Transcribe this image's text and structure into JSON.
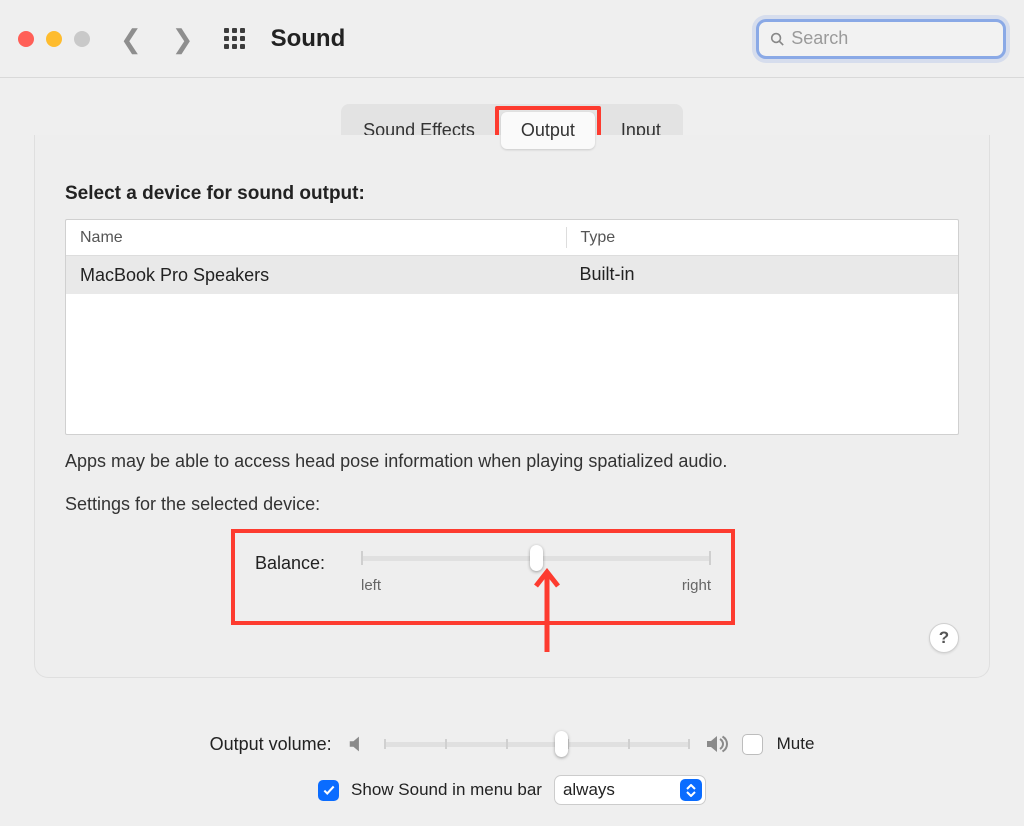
{
  "window": {
    "title": "Sound"
  },
  "search": {
    "placeholder": "Search",
    "value": ""
  },
  "tabs": {
    "soundEffects": "Sound Effects",
    "output": "Output",
    "input": "Input",
    "active": "output"
  },
  "output": {
    "selectTitle": "Select a device for sound output:",
    "columns": {
      "name": "Name",
      "type": "Type"
    },
    "devices": [
      {
        "name": "MacBook Pro Speakers",
        "type": "Built-in"
      }
    ],
    "note": "Apps may be able to access head pose information when playing spatialized audio.",
    "settingsHeader": "Settings for the selected device:",
    "balance": {
      "label": "Balance:",
      "left": "left",
      "right": "right",
      "value": 0.5
    }
  },
  "footer": {
    "volumeLabel": "Output volume:",
    "volume": 0.58,
    "muteLabel": "Mute",
    "muteChecked": false,
    "showMenuLabel": "Show Sound in menu bar",
    "showMenuChecked": true,
    "showMenuMode": "always"
  },
  "help": "?",
  "annotations": {
    "outputTabHighlighted": true,
    "balanceHighlighted": true
  }
}
